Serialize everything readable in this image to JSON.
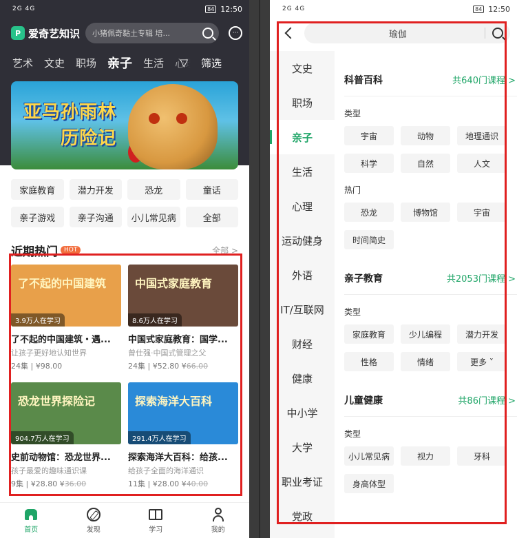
{
  "left": {
    "status": {
      "signal": "2G 4G",
      "time": "12:50",
      "battery": "84"
    },
    "app_name": "爱奇艺知识",
    "logo_letter": "P",
    "search_placeholder": "小猪佩奇黏土专辑  培...",
    "categories": [
      "艺术",
      "文史",
      "职场",
      "亲子",
      "生活",
      "心理"
    ],
    "active_category": "亲子",
    "filter_label": "筛选",
    "banner": {
      "line1": "亚马孙雨林",
      "line2": "历险记"
    },
    "tags": [
      "家庭教育",
      "潜力开发",
      "恐龙",
      "童话",
      "亲子游戏",
      "亲子沟通",
      "小儿常见病",
      "全部"
    ],
    "hot": {
      "title": "近期热门",
      "badge": "HOT",
      "more": "全部 >"
    },
    "courses": [
      {
        "thumb_title": "了不起的中国建筑",
        "learners": "3.9万人在学习",
        "title": "了不起的中国建筑・遇...",
        "subtitle": "让孩子更好地认知世界",
        "meta": "24集 | ¥98.00",
        "old_price": "",
        "bg": "#e8a04a"
      },
      {
        "thumb_title": "中国式家庭教育",
        "learners": "8.6万人在学习",
        "title": "中国式家庭教育：国学...",
        "subtitle": "曾仕强·中国式管理之父",
        "meta": "24集 | ¥52.80",
        "old_price": "66.00",
        "bg": "#6a4a3a"
      },
      {
        "thumb_title": "恐龙世界探险记",
        "learners": "904.7万人在学习",
        "title": "史前动物馆：恐龙世界...",
        "subtitle": "孩子最爱的趣味通识课",
        "meta": "9集 | ¥28.80",
        "old_price": "36.00",
        "bg": "#5a8a4a"
      },
      {
        "thumb_title": "探索海洋大百科",
        "learners": "291.4万人在学习",
        "title": "探索海洋大百科：给孩...",
        "subtitle": "给孩子全面的海洋通识",
        "meta": "11集 | ¥28.00",
        "old_price": "40.00",
        "bg": "#2a8ad8"
      }
    ],
    "tabs": [
      {
        "label": "首页",
        "icon": "home-icon"
      },
      {
        "label": "发现",
        "icon": "compass-icon"
      },
      {
        "label": "学习",
        "icon": "book-icon"
      },
      {
        "label": "我的",
        "icon": "user-icon"
      }
    ]
  },
  "right": {
    "status": {
      "signal": "2G 4G",
      "time": "12:50",
      "battery": "84"
    },
    "search_query": "瑜伽",
    "side_items": [
      "文史",
      "职场",
      "亲子",
      "生活",
      "心理",
      "运动健身",
      "外语",
      "IT/互联网",
      "财经",
      "健康",
      "中小学",
      "大学",
      "职业考证",
      "党政"
    ],
    "active_side": "亲子",
    "sections": [
      {
        "title": "科普百科",
        "count": "共640门课程 >",
        "groups": [
          {
            "label": "类型",
            "chips": [
              "宇宙",
              "动物",
              "地理通识",
              "科学",
              "自然",
              "人文"
            ]
          },
          {
            "label": "热门",
            "chips": [
              "恐龙",
              "博物馆",
              "宇宙",
              "时间简史"
            ]
          }
        ]
      },
      {
        "title": "亲子教育",
        "count": "共2053门课程 >",
        "groups": [
          {
            "label": "类型",
            "chips": [
              "家庭教育",
              "少儿编程",
              "潜力开发",
              "性格",
              "情绪",
              "更多 ˅"
            ]
          }
        ]
      },
      {
        "title": "儿童健康",
        "count": "共86门课程 >",
        "groups": [
          {
            "label": "类型",
            "chips": [
              "小儿常见病",
              "视力",
              "牙科",
              "身高体型"
            ]
          }
        ]
      }
    ]
  },
  "colors": {
    "accent": "#1fa567",
    "highlight_box": "#e02020",
    "header_bg": "#2f2f37"
  }
}
